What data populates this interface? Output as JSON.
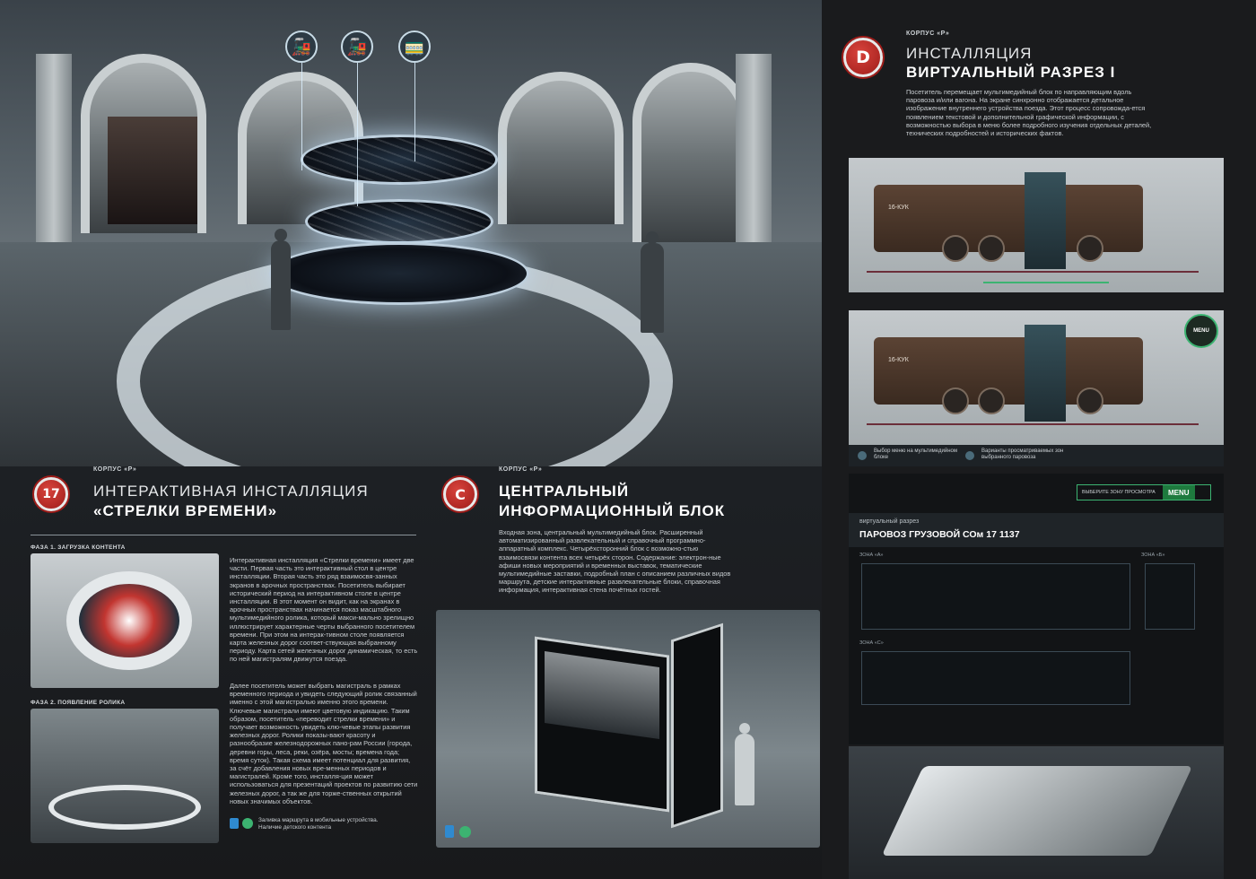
{
  "left": {
    "section17": {
      "kicker": "КОРПУС «Р»",
      "badge": "17",
      "title_line1": "ИНТЕРАКТИВНАЯ ИНСТАЛЛЯЦИЯ",
      "title_line2": "«СТРЕЛКИ ВРЕМЕНИ»",
      "phase1": "ФАЗА 1. ЗАГРУЗКА КОНТЕНТА",
      "phase2": "ФАЗА 2. ПОЯВЛЕНИЕ РОЛИКА",
      "para1": "Интерактивная инсталляция «Стрелки времени» имеет две части. Первая часть это интерактивный стол в центре инсталляции. Вторая часть это ряд взаимосвя-занных экранов в арочных пространствах. Посетитель выбирает исторический период на интерактивном столе в центре инсталляции. В этот момент он видит, как на экранах в арочных пространствах начинается показ масштабного мультимедийного ролика, который макси-мально зрелищно иллюстрирует характерные черты выбранного посетителем времени. При этом на интерак-тивном столе появляется карта железных дорог соответ-ствующая выбранному периоду. Карта сетей железных дорог динамическая, то есть по ней магистралям движутся поезда.",
      "para2": "Далее посетитель может выбрать магистраль в рамках временного периода и увидеть следующий ролик связанный именно с этой магистралью именно этого времени. Ключевые магистрали имеют цветовую индикацию. Таким образом, посетитель «переводит стрелки времени» и получает возможность увидеть клю-чевые этапы развития железных дорог. Ролики показы-вают красоту и разнообразие железнодорожных пано-рам России (города, деревни горы, леса, реки, озёра, мосты; времена года; время суток). Такая схема имеет потенциал для развития, за счёт добавления новых вре-менных периодов и магистралей. Кроме того, инсталля-ция может использоваться для презентаций проектов по развитию сети железных дорог, а так же для торже-ственных открытий новых значимых объектов.",
      "legend_line1": "Заливка маршрута в мобильные устройства.",
      "legend_line2": "Наличие детского контента"
    },
    "sectionC": {
      "kicker": "КОРПУС «Р»",
      "badge": "C",
      "title_line1": "ЦЕНТРАЛЬНЫЙ",
      "title_line2": "ИНФОРМАЦИОННЫЙ БЛОК",
      "body": "Входная зона, центральный мультимедийный блок. Расширенный автоматизированный развлекательный и справочный программно-аппаратный комплекс. Четырёхсторонний блок с возможно-стью взаимосвязи контента всех четырёх сторон. Содержание: электрон-ные афиши новых мероприятий и временных выставок, тематические мультимедийные заставки, подробный план с описанием различных видов маршрута, детские интерактивные развлекательные блоки, справочная информация, интерактивная стена почётных гостей."
    },
    "hero_icons": [
      "locomotive-icon",
      "steam-engine-icon",
      "railcar-icon"
    ]
  },
  "right": {
    "sectionD": {
      "kicker": "КОРПУС «Р»",
      "badge": "D",
      "title_line1": "ИНСТАЛЛЯЦИЯ",
      "title_line2": "ВИРТУАЛЬНЫЙ РАЗРЕЗ I",
      "body": "Посетитель перемещает мультимедийный блок по направляющим вдоль паровоза и/или вагона. На экране синхронно отображается детальное изображение внутреннего устройства поезда. Этот процесс сопровожда-ется появлением текстовой и дополнительной графической информации, с возможностью выбора в меню более подробного изучения отдельных деталей, технических подробностей и исторических фактов."
    },
    "loco_number": "16-КУК",
    "menu_badge": "MENU",
    "caption1": "Выбор меню на мультимедийном блоке",
    "caption2": "Варианты просматриваемых зон выбранного паровоза",
    "screen": {
      "select_zone": "ВЫБЕРИТЕ ЗОНУ ПРОСМОТРА",
      "menu": "MENU",
      "subtitle": "виртуальный разрез",
      "title": "ПАРОВОЗ ГРУЗОВОЙ СОм 17 1137",
      "zone_a": "ЗОНА «А»",
      "zone_b": "ЗОНА «Б»",
      "zone_c": "ЗОНА «С»"
    },
    "accent_color": "#3cb371",
    "badge_color": "#c0302b"
  }
}
